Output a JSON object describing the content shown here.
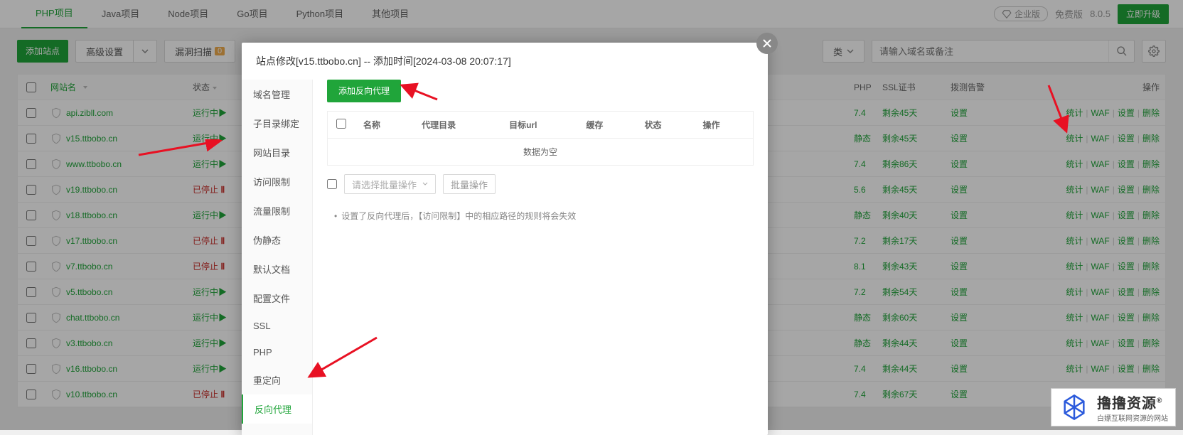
{
  "projectTabs": [
    "PHP项目",
    "Java项目",
    "Node项目",
    "Go项目",
    "Python项目",
    "其他项目"
  ],
  "projectTabActive": 0,
  "header": {
    "enterprise": "企业版",
    "free": "免费版",
    "version": "8.0.5",
    "upgrade": "立即升级"
  },
  "toolbar": {
    "addSite": "添加站点",
    "advanced": "高级设置",
    "vulnScan": "漏洞扫描",
    "vulnCount": "0",
    "classify": "类",
    "searchPlaceholder": "请输入域名或备注"
  },
  "columns": {
    "name": "网站名",
    "status": "状态",
    "php": "PHP",
    "ssl": "SSL证书",
    "alert": "拨测告警",
    "ops": "操作"
  },
  "opLabels": {
    "stats": "统计",
    "waf": "WAF",
    "settings": "设置",
    "delete": "删除"
  },
  "statusText": {
    "running": "运行中",
    "stopped": "已停止"
  },
  "rows": [
    {
      "name": "api.zibll.com",
      "status": "running",
      "php": "7.4",
      "ssl": "剩余45天",
      "alert": "设置"
    },
    {
      "name": "v15.ttbobo.cn",
      "status": "running",
      "php": "静态",
      "ssl": "剩余45天",
      "alert": "设置"
    },
    {
      "name": "www.ttbobo.cn",
      "status": "running",
      "php": "7.4",
      "ssl": "剩余86天",
      "alert": "设置"
    },
    {
      "name": "v19.ttbobo.cn",
      "status": "stopped",
      "php": "5.6",
      "ssl": "剩余45天",
      "alert": "设置"
    },
    {
      "name": "v18.ttbobo.cn",
      "status": "running",
      "php": "静态",
      "ssl": "剩余40天",
      "alert": "设置"
    },
    {
      "name": "v17.ttbobo.cn",
      "status": "stopped",
      "php": "7.2",
      "ssl": "剩余17天",
      "alert": "设置"
    },
    {
      "name": "v7.ttbobo.cn",
      "status": "stopped",
      "php": "8.1",
      "ssl": "剩余43天",
      "alert": "设置"
    },
    {
      "name": "v5.ttbobo.cn",
      "status": "running",
      "php": "7.2",
      "ssl": "剩余54天",
      "alert": "设置"
    },
    {
      "name": "chat.ttbobo.cn",
      "status": "running",
      "php": "静态",
      "ssl": "剩余60天",
      "alert": "设置"
    },
    {
      "name": "v3.ttbobo.cn",
      "status": "running",
      "php": "静态",
      "ssl": "剩余44天",
      "alert": "设置"
    },
    {
      "name": "v16.ttbobo.cn",
      "status": "running",
      "php": "7.4",
      "ssl": "剩余44天",
      "alert": "设置"
    },
    {
      "name": "v10.ttbobo.cn",
      "status": "stopped",
      "php": "7.4",
      "ssl": "剩余67天",
      "alert": "设置"
    }
  ],
  "modal": {
    "title": "站点修改[v15.ttbobo.cn] -- 添加时间[2024-03-08 20:07:17]",
    "sideItems": [
      "域名管理",
      "子目录绑定",
      "网站目录",
      "访问限制",
      "流量限制",
      "伪静态",
      "默认文档",
      "配置文件",
      "SSL",
      "PHP",
      "重定向",
      "反向代理"
    ],
    "sideActive": 11,
    "addProxy": "添加反向代理",
    "innerCols": [
      "名称",
      "代理目录",
      "目标url",
      "缓存",
      "状态",
      "操作"
    ],
    "empty": "数据为空",
    "bulkPlaceholder": "请选择批量操作",
    "bulkAction": "批量操作",
    "hint": "设置了反向代理后，【访问限制】中的相应路径的规则将会失效"
  },
  "watermark": {
    "big": "撸撸资源",
    "small": "白嫖互联网资源的网站",
    "reg": "®"
  }
}
